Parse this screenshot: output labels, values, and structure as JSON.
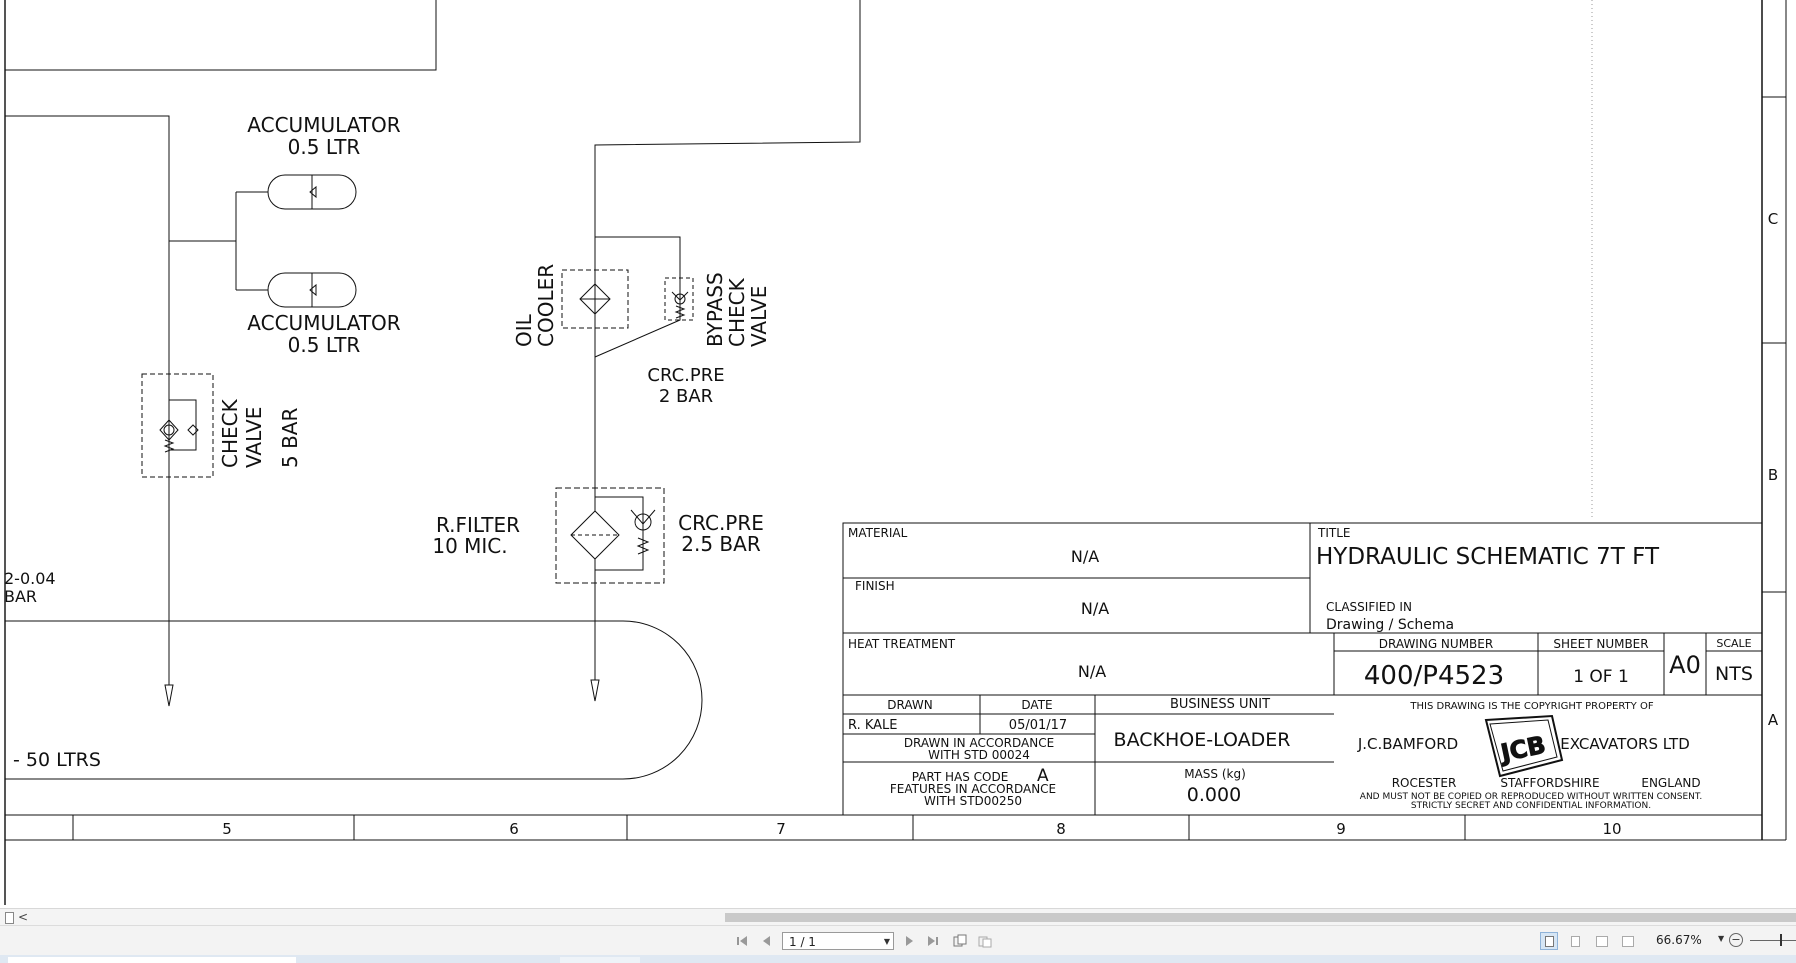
{
  "schematic": {
    "accumulator_top": {
      "name": "ACCUMULATOR",
      "capacity": "0.5 LTR"
    },
    "accumulator_bottom": {
      "name": "ACCUMULATOR",
      "capacity": "0.5 LTR"
    },
    "check_valve": {
      "line1": "CHECK",
      "line2": "VALVE",
      "line3": "5 BAR"
    },
    "oil_cooler": {
      "line1": "OIL",
      "line2": "COOLER"
    },
    "bypass_check_valve": {
      "line1": "BYPASS",
      "line2": "CHECK",
      "line3": "VALVE"
    },
    "cooler_crc": {
      "line1": "CRC.PRE",
      "line2": "2 BAR"
    },
    "return_filter": {
      "line1": "R.FILTER",
      "line2": "10 MIC."
    },
    "filter_crc": {
      "line1": "CRC.PRE",
      "line2": "2.5 BAR"
    },
    "partial_pressure": {
      "line1": "2-0.04",
      "line2": "BAR"
    },
    "tank_capacity": "- 50 LTRS"
  },
  "grid": {
    "columns": [
      "5",
      "6",
      "7",
      "8",
      "9",
      "10"
    ],
    "rows": [
      "C",
      "B",
      "A"
    ]
  },
  "title_block": {
    "material_label": "MATERIAL",
    "material_value": "N/A",
    "finish_label": "FINISH",
    "finish_value": "N/A",
    "heat_label": "HEAT TREATMENT",
    "heat_value": "N/A",
    "title_label": "TITLE",
    "title_value": "HYDRAULIC SCHEMATIC 7T FT",
    "classified_label": "CLASSIFIED IN",
    "classified_value": "Drawing / Schema",
    "drawing_number_label": "DRAWING NUMBER",
    "drawing_number": "400/P4523",
    "sheet_number_label": "SHEET NUMBER",
    "sheet_number": "1  OF  1",
    "size": "A0",
    "scale_label": "SCALE",
    "scale": "NTS",
    "drawn_label": "DRAWN",
    "drawn_value": "R. KALE",
    "date_label": "DATE",
    "date_value": "05/01/17",
    "business_unit_label": "BUSINESS UNIT",
    "business_unit": "BACKHOE-LOADER",
    "std_line1": "DRAWN  IN  ACCORDANCE",
    "std_line2": "WITH  STD  00024",
    "part_code_line1": "PART  HAS  CODE",
    "part_code_value": "A",
    "part_code_line2": "FEATURES  IN  ACCORDANCE",
    "part_code_line3": "WITH  STD00250",
    "mass_label": "MASS (kg)",
    "mass_value": "0.000",
    "copyright_header": "THIS DRAWING IS THE COPYRIGHT PROPERTY OF",
    "company_left": "J.C.BAMFORD",
    "company_right": "EXCAVATORS LTD",
    "logo_text": "JCB",
    "address_1": "ROCESTER",
    "address_2": "STAFFORDSHIRE",
    "address_3": "ENGLAND",
    "notice_1": "AND MUST NOT BE COPIED OR REPRODUCED WITHOUT WRITTEN CONSENT.",
    "notice_2": "STRICTLY SECRET AND CONFIDENTIAL INFORMATION."
  },
  "viewer": {
    "page_indicator": "1 / 1",
    "zoom": "66.67%",
    "scroll_left_arrow": "<",
    "nav_first": "first-page-icon",
    "nav_prev": "previous-page-icon",
    "nav_next": "next-page-icon",
    "nav_last": "last-page-icon"
  }
}
